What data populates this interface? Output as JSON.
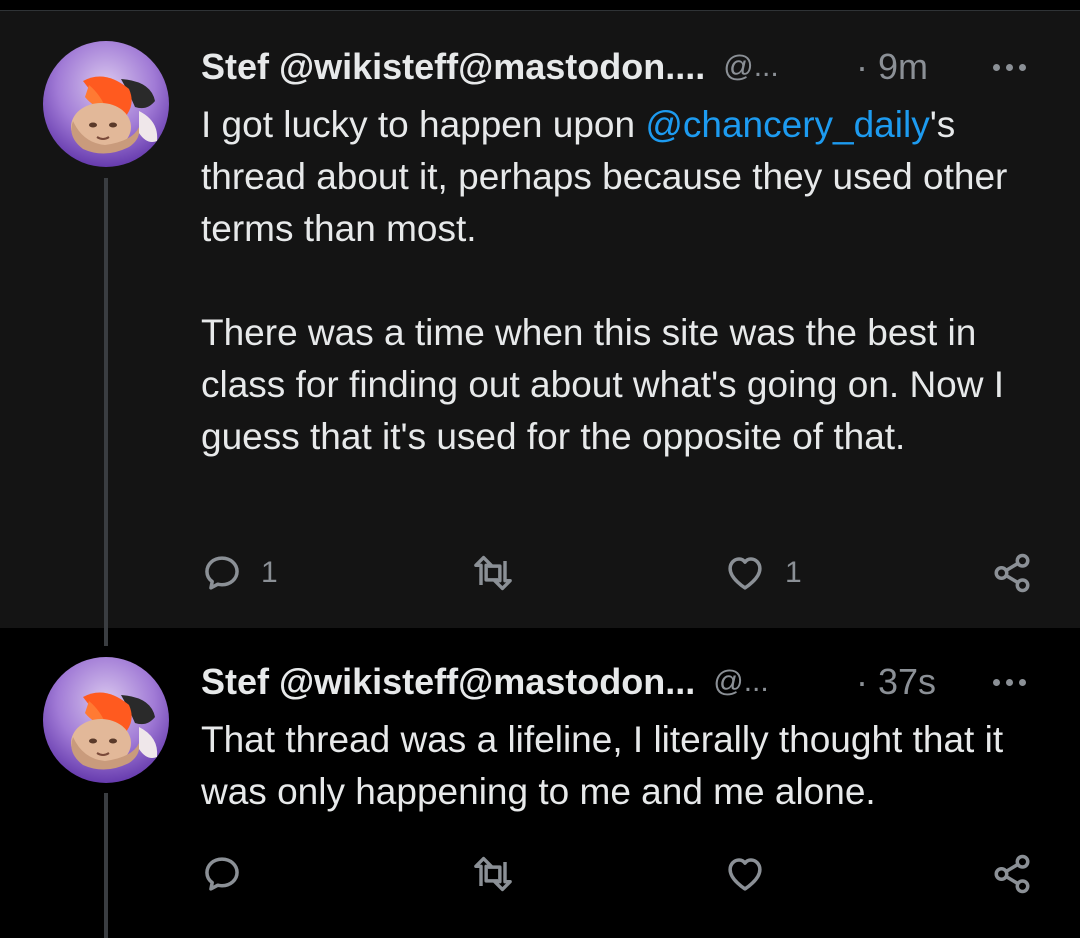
{
  "colors": {
    "background": "#000000",
    "tweet_background": "#141414",
    "text": "#e7e9ea",
    "muted": "#8b9096",
    "mention": "#1d9bf0"
  },
  "tweets": [
    {
      "display_name": "Stef @wikisteff@mastodon....",
      "handle": "@...",
      "time": "· 9m",
      "body_before_mention": "I got lucky to happen upon ",
      "mention": "@chancery_daily",
      "body_after_mention": "'s thread about it, perhaps because they used other terms than most.\n\nThere was a time when this site was the best in class for finding out about what's going on. Now I guess that it's used for the opposite of that.",
      "actions": {
        "reply_count": "1",
        "repost_count": "",
        "like_count": "1"
      },
      "icons": [
        "avatar",
        "more-icon",
        "reply-icon",
        "repost-icon",
        "like-icon",
        "share-icon"
      ]
    },
    {
      "display_name": "Stef @wikisteff@mastodon...",
      "handle": "@...",
      "time": "· 37s",
      "body": "That thread was a lifeline, I literally thought that it was only happening to me and me alone.",
      "actions": {
        "reply_count": "",
        "repost_count": "",
        "like_count": ""
      },
      "icons": [
        "avatar",
        "more-icon",
        "reply-icon",
        "repost-icon",
        "like-icon",
        "share-icon"
      ]
    }
  ]
}
